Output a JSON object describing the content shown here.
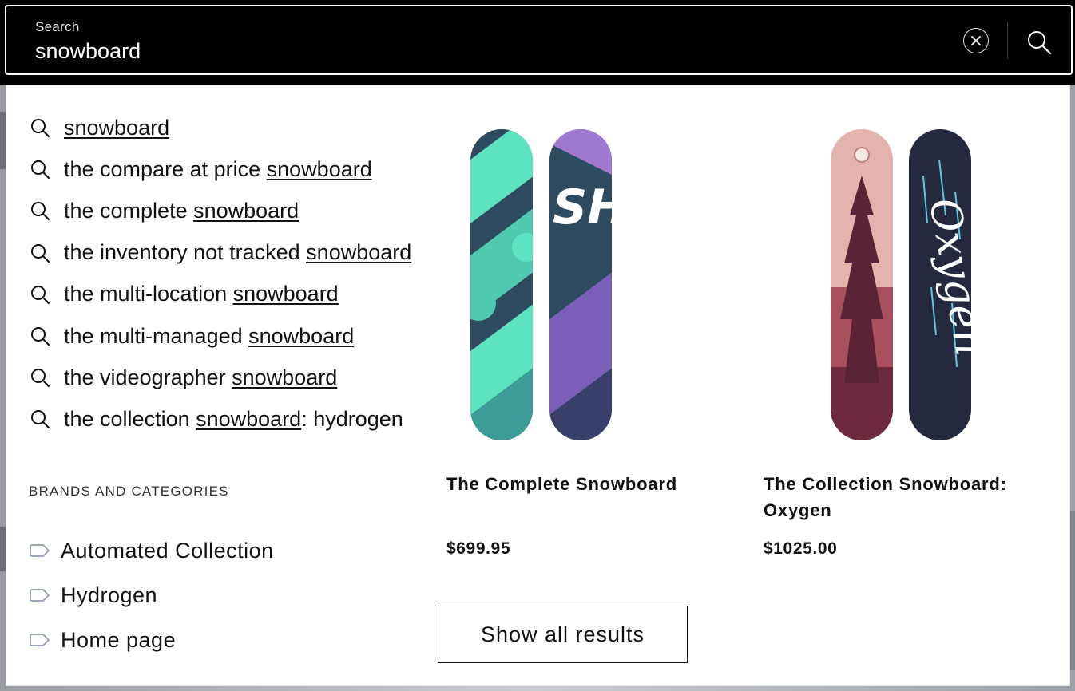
{
  "search": {
    "label": "Search",
    "value": "snowboard"
  },
  "suggestions": [
    {
      "prefix": "",
      "match": "snowboard",
      "suffix": ""
    },
    {
      "prefix": "the compare at price ",
      "match": "snowboard",
      "suffix": ""
    },
    {
      "prefix": "the complete ",
      "match": "snowboard",
      "suffix": ""
    },
    {
      "prefix": "the inventory not tracked ",
      "match": "snowboard",
      "suffix": ""
    },
    {
      "prefix": "the multi-location ",
      "match": "snowboard",
      "suffix": ""
    },
    {
      "prefix": "the multi-managed ",
      "match": "snowboard",
      "suffix": ""
    },
    {
      "prefix": "the videographer ",
      "match": "snowboard",
      "suffix": ""
    },
    {
      "prefix": "the collection ",
      "match": "snowboard",
      "suffix": ": hydrogen"
    }
  ],
  "brands_section": {
    "title": "BRANDS AND CATEGORIES",
    "items": [
      "Automated Collection",
      "Hydrogen",
      "Home page"
    ]
  },
  "products": [
    {
      "title": "The Complete Snowboard",
      "price": "$699.95",
      "board_text": "SHOPIFY"
    },
    {
      "title": "The Collection Snowboard: Oxygen",
      "price": "$1025.00",
      "board_text": "Oxygen"
    }
  ],
  "show_all_label": "Show all results",
  "colors": {
    "bar_bg": "#000000",
    "text": "#111111",
    "teal": "#5ee3c0",
    "purple": "#a07ad0",
    "pink": "#e3b3ad",
    "navy": "#25293f"
  }
}
